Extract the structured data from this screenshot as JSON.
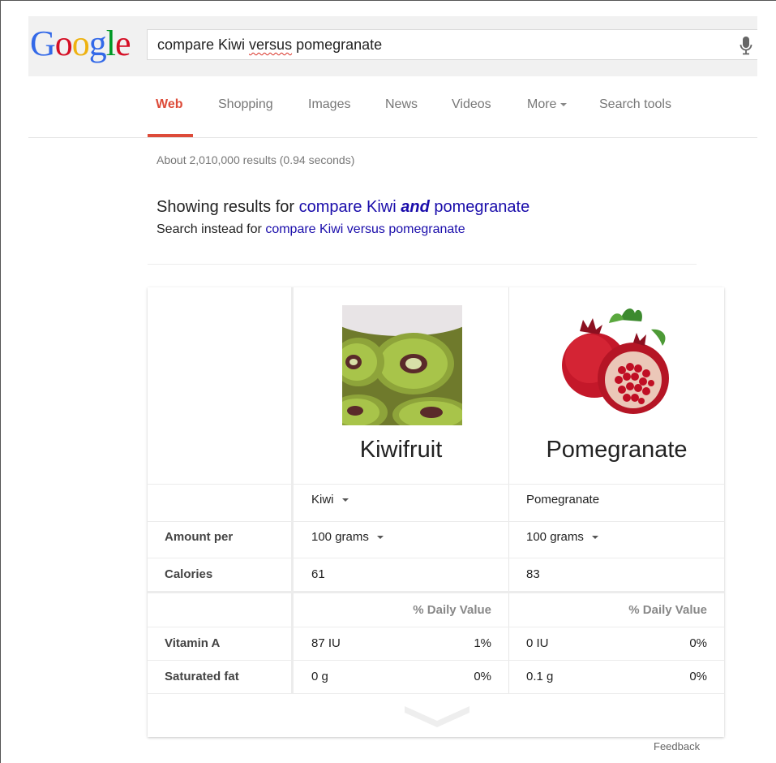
{
  "logo": {
    "letters": [
      "G",
      "o",
      "o",
      "g",
      "l",
      "e"
    ],
    "colors": [
      "#3369e8",
      "#d50f25",
      "#eeb211",
      "#3369e8",
      "#009925",
      "#d50f25"
    ]
  },
  "search": {
    "before": "compare Kiwi ",
    "misspelled": "versus",
    "after": " pomegranate"
  },
  "tabs": [
    {
      "label": "Web"
    },
    {
      "label": "Shopping"
    },
    {
      "label": "Images"
    },
    {
      "label": "News"
    },
    {
      "label": "Videos"
    },
    {
      "label": "More"
    },
    {
      "label": "Search tools"
    }
  ],
  "results_stats": "About 2,010,000 results (0.94 seconds)",
  "correction": {
    "showing_prefix": "Showing results for",
    "link_start": "compare Kiwi",
    "link_emph": "and",
    "link_end": "pomegranate",
    "instead_prefix": "Search instead for",
    "instead_link": "compare Kiwi versus pomegranate"
  },
  "comparison": {
    "foods": [
      {
        "name": "Kiwifruit",
        "variety": "Kiwi",
        "amount": "100 grams",
        "calories": "61",
        "vitamin_a": "87 IU",
        "vitamin_a_dv": "1%",
        "sat_fat": "0 g",
        "sat_fat_dv": "0%"
      },
      {
        "name": "Pomegranate",
        "variety": "Pomegranate",
        "amount": "100 grams",
        "calories": "83",
        "vitamin_a": "0 IU",
        "vitamin_a_dv": "0%",
        "sat_fat": "0.1 g",
        "sat_fat_dv": "0%"
      }
    ],
    "labels": {
      "amount": "Amount per",
      "calories": "Calories",
      "vitamin_a": "Vitamin A",
      "sat_fat": "Saturated fat",
      "daily_value": "% Daily Value"
    }
  },
  "feedback": "Feedback",
  "colors": {
    "accent": "#dd4b39",
    "link": "#1a0dab"
  }
}
